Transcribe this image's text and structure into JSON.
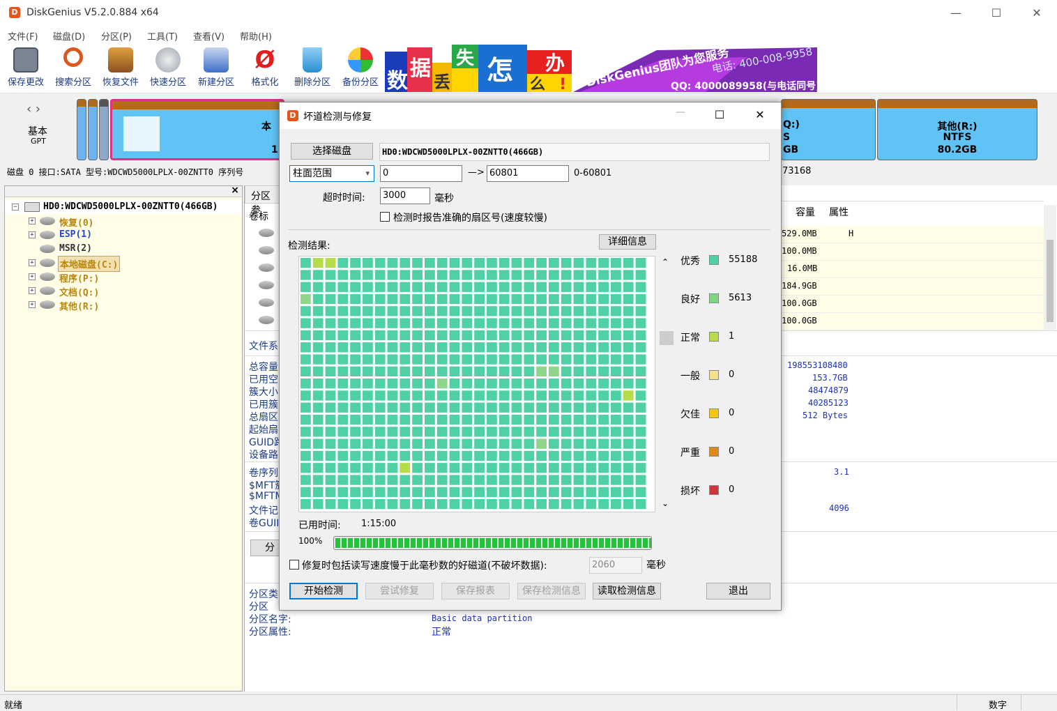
{
  "window": {
    "title": "DiskGenius V5.2.0.884 x64",
    "min_glyph": "—",
    "max_glyph": "☐",
    "close_glyph": "✕"
  },
  "menu": [
    "文件(F)",
    "磁盘(D)",
    "分区(P)",
    "工具(T)",
    "查看(V)",
    "帮助(H)"
  ],
  "toolbar": [
    {
      "label": "保存更改",
      "icon": "save-icon",
      "color": "#7a8591"
    },
    {
      "label": "搜索分区",
      "icon": "search-icon",
      "color": "#d9581f"
    },
    {
      "label": "恢复文件",
      "icon": "recover-icon",
      "color": "#b87333"
    },
    {
      "label": "快速分区",
      "icon": "quick-partition-icon",
      "color": "#9aa5b1"
    },
    {
      "label": "新建分区",
      "icon": "new-partition-icon",
      "color": "#3f6fc9"
    },
    {
      "label": "格式化",
      "icon": "format-icon",
      "color": "#e02020"
    },
    {
      "label": "删除分区",
      "icon": "delete-icon",
      "color": "#2a8fd0"
    },
    {
      "label": "备份分区",
      "icon": "backup-icon",
      "color": "#f0a020"
    }
  ],
  "banner": {
    "chars": [
      "数",
      "据",
      "丢",
      "失",
      "怎",
      "么",
      "办",
      "!"
    ],
    "brand": "DiskGenius团队为您服务",
    "phone": "电话: 400-008-9958",
    "qq": "QQ: 4000089958(与电话同号)"
  },
  "diskmap": {
    "nav_label1": "基本",
    "nav_label2": "GPT",
    "main_partition_text": "本",
    "main_partition_text2": "1",
    "partition_q_line1": "Q:)",
    "partition_q_line2": "S",
    "partition_q_line3": "GB",
    "partition_r_line1": "其他(R:)",
    "partition_r_line2": "NTFS",
    "partition_r_line3": "80.2GB"
  },
  "diskinfo": {
    "text": "磁盘 0 接口:SATA  型号:WDCWD5000LPLX-00ZNTT0  序列号",
    "tail": "73168"
  },
  "tree": {
    "close_glyph": "×",
    "disk": "HD0:WDCWD5000LPLX-00ZNTT0(466GB)",
    "items": [
      {
        "label": "恢复(0)",
        "color": "#b8860b"
      },
      {
        "label": "ESP(1)",
        "color": "#2244cc"
      },
      {
        "label": "MSR(2)",
        "color": "#333333"
      },
      {
        "label": "本地磁盘(C:)",
        "color": "#b8860b"
      },
      {
        "label": "程序(P:)",
        "color": "#b8860b"
      },
      {
        "label": "文档(Q:)",
        "color": "#b8860b"
      },
      {
        "label": "其他(R:)",
        "color": "#b8860b"
      }
    ]
  },
  "right": {
    "tab_label": "分区参",
    "col_volume": "卷标",
    "col_capacity": "容量",
    "col_attr": "属性",
    "rows": [
      {
        "cap": "529.0MB",
        "attr": "H"
      },
      {
        "cap": "100.0MB",
        "attr": ""
      },
      {
        "cap": "16.0MB",
        "attr": ""
      },
      {
        "cap": "184.9GB",
        "attr": ""
      },
      {
        "cap": "100.0GB",
        "attr": ""
      },
      {
        "cap": "100.0GB",
        "attr": ""
      }
    ],
    "fs_label": "文件系",
    "left_labels": [
      "总容量",
      "已用空",
      "簇大小",
      "已用簇",
      "总扇区",
      "起始扇",
      "GUID路",
      "设备路"
    ],
    "right_values": [
      "198553108480",
      "153.7GB",
      "48474879",
      "40285123",
      "512 Bytes"
    ],
    "left_labels2": [
      "卷序列",
      "$MFT簇",
      "$MFTMi",
      "文件记",
      "卷GUII"
    ],
    "val_31": "3.1",
    "val_4096": "4096",
    "analyze_btn": "分",
    "bottom_labels": [
      "分区类",
      "分区",
      "分区名字:",
      "分区属性:"
    ],
    "partition_name_val": "Basic data partition",
    "partition_attr_val": "正常"
  },
  "status": {
    "left": "就绪",
    "right": "数字"
  },
  "dialog": {
    "title": "坏道检测与修复",
    "select_disk_btn": "选择磁盘",
    "disk_name": "HD0:WDCWD5000LPLX-00ZNTT0(466GB)",
    "range_mode": "柱面范围",
    "range_start": "0",
    "arrow": "—>",
    "range_end": "60801",
    "range_hint": "0-60801",
    "timeout_label": "超时时间:",
    "timeout_value": "3000",
    "timeout_unit": "毫秒",
    "report_sector_label": "检测时报告准确的扇区号(速度较慢)",
    "result_label": "检测结果:",
    "detail_btn": "详细信息",
    "legend": [
      {
        "label": "优秀",
        "color": "#4fd1a5",
        "count": "55188"
      },
      {
        "label": "良好",
        "color": "#7fd67f",
        "count": "5613"
      },
      {
        "label": "正常",
        "color": "#b5dd4a",
        "count": "1"
      },
      {
        "label": "一般",
        "color": "#f6e08a",
        "count": "0"
      },
      {
        "label": "欠佳",
        "color": "#f5c518",
        "count": "0"
      },
      {
        "label": "严重",
        "color": "#e08a1e",
        "count": "0"
      },
      {
        "label": "损坏",
        "color": "#d0343c",
        "count": "0"
      }
    ],
    "elapsed_label": "已用时间:",
    "elapsed_value": "1:15:00",
    "progress_label": "100%",
    "progress": 1.0,
    "repair_slow_label": "修复时包括读写速度慢于此毫秒数的好磁道(不破坏数据):",
    "repair_slow_value": "2060",
    "repair_slow_unit": "毫秒",
    "buttons": {
      "start": "开始检测",
      "try_repair": "尝试修复",
      "save_report": "保存报表",
      "save_info": "保存检测信息",
      "load_info": "读取检测信息",
      "exit": "退出"
    }
  },
  "colors": {
    "accent": "#1a3c8a",
    "cell_excellent": "#4fd1a5",
    "cell_good": "#8ed68a",
    "cell_normal": "#b5dd4a"
  }
}
